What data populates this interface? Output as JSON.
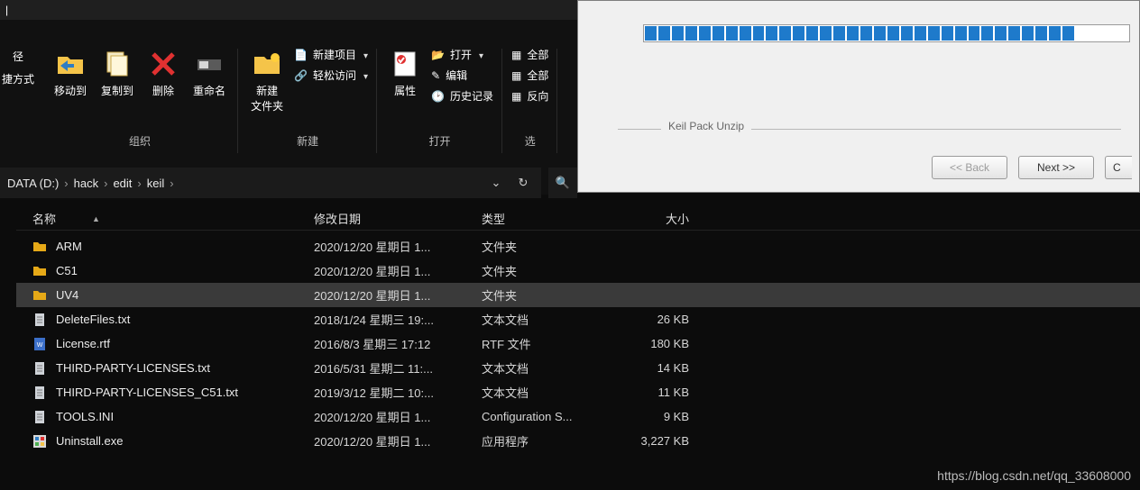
{
  "ribbon": {
    "topstrip": "|",
    "left": {
      "line1": "径",
      "line2": "捷方式"
    },
    "group1": {
      "label": "组织",
      "moveTo": "移动到",
      "copyTo": "复制到",
      "delete": "删除",
      "rename": "重命名"
    },
    "group2": {
      "label": "新建",
      "newFolder": "新建\n文件夹",
      "newItem": "新建项目",
      "easyAccess": "轻松访问"
    },
    "group3": {
      "label": "打开",
      "properties": "属性",
      "open": "打开",
      "edit": "编辑",
      "history": "历史记录"
    },
    "group4": {
      "label": "选",
      "selectAll": "全部",
      "selectAll2": "全部",
      "invert": "反向"
    }
  },
  "breadcrumb": [
    "DATA (D:)",
    "hack",
    "edit",
    "keil"
  ],
  "columns": {
    "name": "名称",
    "date": "修改日期",
    "type": "类型",
    "size": "大小"
  },
  "files": [
    {
      "name": "ARM",
      "date": "2020/12/20 星期日 1...",
      "type": "文件夹",
      "size": "",
      "icon": "folder",
      "selected": false
    },
    {
      "name": "C51",
      "date": "2020/12/20 星期日 1...",
      "type": "文件夹",
      "size": "",
      "icon": "folder",
      "selected": false
    },
    {
      "name": "UV4",
      "date": "2020/12/20 星期日 1...",
      "type": "文件夹",
      "size": "",
      "icon": "folder",
      "selected": true
    },
    {
      "name": "DeleteFiles.txt",
      "date": "2018/1/24 星期三 19:...",
      "type": "文本文档",
      "size": "26 KB",
      "icon": "txt",
      "selected": false
    },
    {
      "name": "License.rtf",
      "date": "2016/8/3 星期三 17:12",
      "type": "RTF 文件",
      "size": "180 KB",
      "icon": "rtf",
      "selected": false
    },
    {
      "name": "THIRD-PARTY-LICENSES.txt",
      "date": "2016/5/31 星期二 11:...",
      "type": "文本文档",
      "size": "14 KB",
      "icon": "txt",
      "selected": false
    },
    {
      "name": "THIRD-PARTY-LICENSES_C51.txt",
      "date": "2019/3/12 星期二 10:...",
      "type": "文本文档",
      "size": "11 KB",
      "icon": "txt",
      "selected": false
    },
    {
      "name": "TOOLS.INI",
      "date": "2020/12/20 星期日 1...",
      "type": "Configuration S...",
      "size": "9 KB",
      "icon": "ini",
      "selected": false
    },
    {
      "name": "Uninstall.exe",
      "date": "2020/12/20 星期日 1...",
      "type": "应用程序",
      "size": "3,227 KB",
      "icon": "exe",
      "selected": false
    }
  ],
  "dialog": {
    "legend": "Keil Pack Unzip",
    "progress_total": 36,
    "progress_filled": 32,
    "back": "<< Back",
    "next": "Next >>",
    "cancel": "C"
  },
  "watermark": "https://blog.csdn.net/qq_33608000"
}
